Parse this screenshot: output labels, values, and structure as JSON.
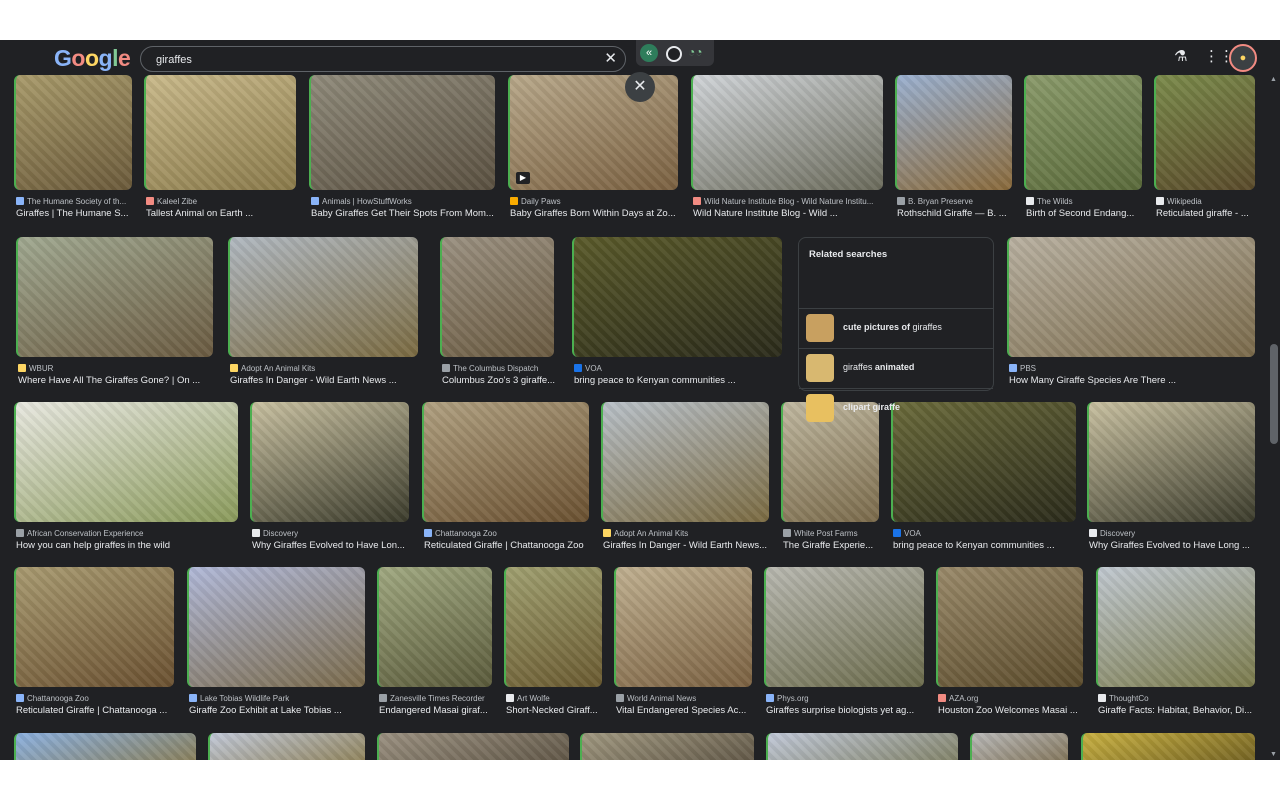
{
  "search": {
    "query": "giraffes"
  },
  "logo_letters": [
    "G",
    "o",
    "o",
    "g",
    "l",
    "e"
  ],
  "related": {
    "title": "Related searches",
    "items": [
      {
        "bold_pre": "cute pictures of",
        "plain": " giraffes",
        "bold_post": ""
      },
      {
        "bold_pre": "",
        "plain": "giraffes ",
        "bold_post": "animated"
      },
      {
        "bold_pre": "clipart giraffe",
        "plain": "",
        "bold_post": ""
      }
    ]
  },
  "results": [
    {
      "source": "The Humane Society of th...",
      "title": "Giraffes | The Humane S...",
      "c1": "#a89a6a",
      "c2": "#6b5a3a",
      "fav": "#8ab4f8"
    },
    {
      "source": "Kaleel Zibe",
      "title": "Tallest Animal on Earth ...",
      "c1": "#c9b98a",
      "c2": "#8a7a4a",
      "fav": "#f28b82"
    },
    {
      "source": "Animals | HowStuffWorks",
      "title": "Baby Giraffes Get Their Spots From Mom...",
      "c1": "#8f8a7a",
      "c2": "#5a5040",
      "fav": "#8ab4f8"
    },
    {
      "source": "Daily Paws",
      "title": "Baby Giraffes Born Within Days at Zo...",
      "c1": "#b8a88a",
      "c2": "#7a6040",
      "fav": "#f9ab00",
      "play": true
    },
    {
      "source": "Wild Nature Institute Blog - Wild Nature Institu...",
      "title": "Wild Nature Institute Blog - Wild ...",
      "c1": "#d0d4d8",
      "c2": "#6a6a5a",
      "fav": "#f28b82"
    },
    {
      "source": "B. Bryan Preserve",
      "title": "Rothschild Giraffe — B. ...",
      "c1": "#9ab0d0",
      "c2": "#8a6a3a",
      "fav": "#9aa0a6"
    },
    {
      "source": "The Wilds",
      "title": "Birth of Second Endang...",
      "c1": "#8a9a6a",
      "c2": "#5a6a3a",
      "fav": "#e8eaed"
    },
    {
      "source": "Wikipedia",
      "title": "Reticulated giraffe - ...",
      "c1": "#7a8a4a",
      "c2": "#5a4a2a",
      "fav": "#e8eaed"
    },
    {
      "source": "WBUR",
      "title": "Where Have All The Giraffes Gone? | On ...",
      "c1": "#a0a890",
      "c2": "#6a5a40",
      "fav": "#fdd663"
    },
    {
      "source": "Adopt An Animal Kits",
      "title": "Giraffes In Danger - Wild Earth News ...",
      "c1": "#b0b8c0",
      "c2": "#7a6a40",
      "fav": "#fdd663"
    },
    {
      "source": "The Columbus Dispatch",
      "title": "Columbus Zoo's 3 giraffe...",
      "c1": "#9a9080",
      "c2": "#6a5a40",
      "fav": "#9aa0a6"
    },
    {
      "source": "VOA",
      "title": "bring peace to Kenyan communities ...",
      "c1": "#5a5a2a",
      "c2": "#2a2a1a",
      "fav": "#1a73e8"
    },
    {
      "source": "PBS",
      "title": "How Many Giraffe Species Are There ...",
      "c1": "#b8b0a0",
      "c2": "#7a6a4a",
      "fav": "#8ab4f8"
    },
    {
      "source": "African Conservation Experience",
      "title": "How you can help giraffes in the wild",
      "c1": "#e8e8e0",
      "c2": "#8a9a5a",
      "fav": "#9aa0a6"
    },
    {
      "source": "Discovery",
      "title": "Why Giraffes Evolved to Have Lon...",
      "c1": "#c8c0a0",
      "c2": "#3a3a2a",
      "fav": "#e8eaed"
    },
    {
      "source": "Chattanooga Zoo",
      "title": "Reticulated Giraffe | Chattanooga Zoo",
      "c1": "#b0a080",
      "c2": "#6a5030",
      "fav": "#8ab4f8"
    },
    {
      "source": "Adopt An Animal Kits",
      "title": "Giraffes In Danger - Wild Earth News...",
      "c1": "#b8c0c8",
      "c2": "#7a6a40",
      "fav": "#fdd663"
    },
    {
      "source": "White Post Farms",
      "title": "The Giraffe Experie...",
      "c1": "#c0b8a0",
      "c2": "#7a6a4a",
      "fav": "#9aa0a6"
    },
    {
      "source": "VOA",
      "title": "bring peace to Kenyan communities ...",
      "c1": "#6a6a3a",
      "c2": "#2a2a1a",
      "fav": "#1a73e8"
    },
    {
      "source": "Discovery",
      "title": "Why Giraffes Evolved to Have Long ...",
      "c1": "#c8c0a0",
      "c2": "#3a3a2a",
      "fav": "#e8eaed"
    },
    {
      "source": "Chattanooga Zoo",
      "title": "Reticulated Giraffe | Chattanooga ...",
      "c1": "#a89a70",
      "c2": "#6a5030",
      "fav": "#8ab4f8"
    },
    {
      "source": "Lake Tobias Wildlife Park",
      "title": "Giraffe Zoo Exhibit at Lake Tobias ...",
      "c1": "#b0b8d8",
      "c2": "#7a6a4a",
      "fav": "#8ab4f8"
    },
    {
      "source": "Zanesville Times Recorder",
      "title": "Endangered Masai giraf...",
      "c1": "#a0a880",
      "c2": "#5a5a3a",
      "fav": "#9aa0a6"
    },
    {
      "source": "Art Wolfe",
      "title": "Short-Necked Giraff...",
      "c1": "#a0a070",
      "c2": "#6a5a30",
      "fav": "#e8eaed"
    },
    {
      "source": "World Animal News",
      "title": "Vital Endangered Species Ac...",
      "c1": "#c0b090",
      "c2": "#7a6040",
      "fav": "#9aa0a6"
    },
    {
      "source": "Phys.org",
      "title": "Giraffes surprise biologists yet ag...",
      "c1": "#b8b8b0",
      "c2": "#6a6a4a",
      "fav": "#8ab4f8"
    },
    {
      "source": "AZA.org",
      "title": "Houston Zoo Welcomes Masai ...",
      "c1": "#9a8a6a",
      "c2": "#5a4a2a",
      "fav": "#f28b82"
    },
    {
      "source": "ThoughtCo",
      "title": "Giraffe Facts: Habitat, Behavior, Di...",
      "c1": "#c0c8d0",
      "c2": "#7a7a4a",
      "fav": "#e8eaed"
    },
    {
      "source": "",
      "title": "",
      "c1": "#8ab0e0",
      "c2": "#8a7a4a",
      "fav": ""
    },
    {
      "source": "",
      "title": "",
      "c1": "#c0c8d8",
      "c2": "#8a7a4a",
      "fav": ""
    },
    {
      "source": "",
      "title": "",
      "c1": "#9a9080",
      "c2": "#5a5040",
      "fav": ""
    },
    {
      "source": "",
      "title": "",
      "c1": "#a09880",
      "c2": "#5a5040",
      "fav": ""
    },
    {
      "source": "",
      "title": "",
      "c1": "#c0c8d8",
      "c2": "#7a7a5a",
      "fav": ""
    },
    {
      "source": "",
      "title": "",
      "c1": "#b8b8b8",
      "c2": "#7a6a4a",
      "fav": ""
    },
    {
      "source": "",
      "title": "",
      "c1": "#c8b040",
      "c2": "#6a5a20",
      "fav": ""
    }
  ]
}
